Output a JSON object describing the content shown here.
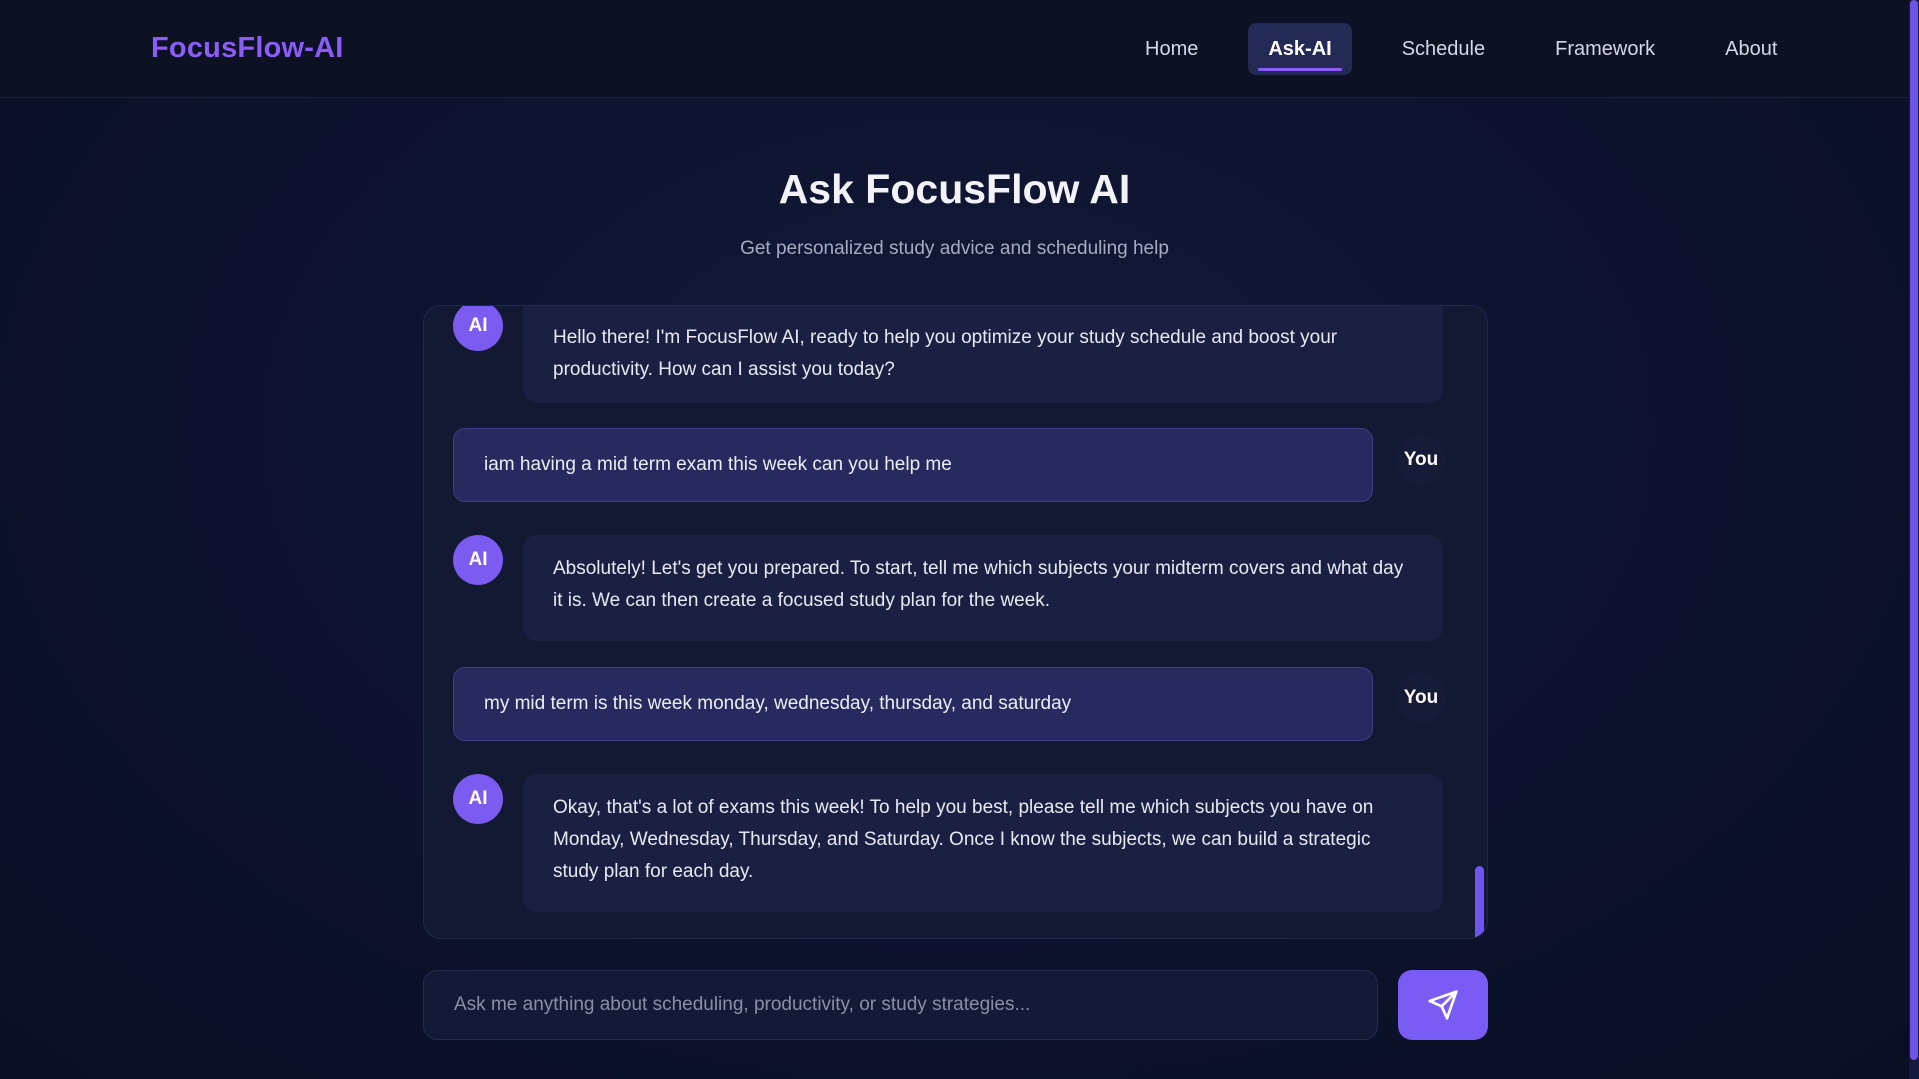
{
  "header": {
    "logo": "FocusFlow-AI",
    "nav": [
      {
        "label": "Home",
        "active": false
      },
      {
        "label": "Ask-AI",
        "active": true
      },
      {
        "label": "Schedule",
        "active": false
      },
      {
        "label": "Framework",
        "active": false
      },
      {
        "label": "About",
        "active": false
      }
    ]
  },
  "page": {
    "title": "Ask FocusFlow AI",
    "subtitle": "Get personalized study advice and scheduling help"
  },
  "chat": {
    "messages": [
      {
        "sender": "AI",
        "avatar": "AI",
        "text": "Hello there! I'm FocusFlow AI, ready to help you optimize your study schedule and boost your productivity. How can I assist you today?"
      },
      {
        "sender": "You",
        "avatar": "You",
        "text": "iam having a mid term exam this week can you help me"
      },
      {
        "sender": "AI",
        "avatar": "AI",
        "text": "Absolutely! Let's get you prepared. To start, tell me which subjects your midterm covers and what day it is. We can then create a focused study plan for the week."
      },
      {
        "sender": "You",
        "avatar": "You",
        "text": "my mid term is this week monday, wednesday, thursday, and saturday"
      },
      {
        "sender": "AI",
        "avatar": "AI",
        "text": "Okay, that's a lot of exams this week! To help you best, please tell me which subjects you have on Monday, Wednesday, Thursday, and Saturday. Once I know the subjects, we can build a strategic study plan for each day."
      }
    ]
  },
  "input": {
    "value": "",
    "placeholder": "Ask me anything about scheduling, productivity, or study strategies..."
  },
  "icons": {
    "send": "send-icon"
  },
  "colors": {
    "accent": "#7c5cf0",
    "logo": "#8b5cf6",
    "background": "#0e1330",
    "user_bubble": "#28295f",
    "ai_bubble": "#1b2042"
  }
}
